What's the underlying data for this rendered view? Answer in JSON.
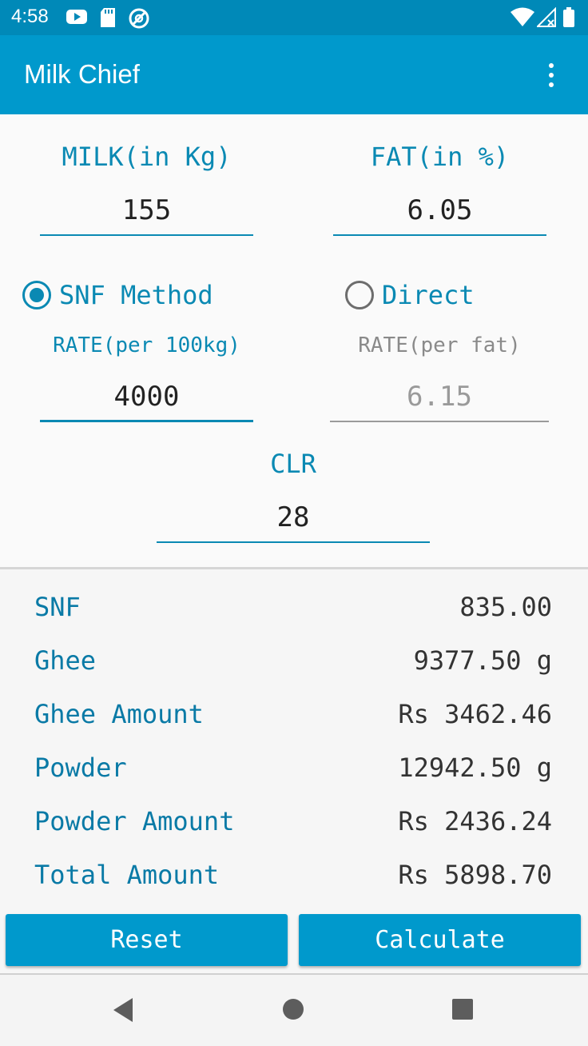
{
  "status_bar": {
    "time": "4:58",
    "left_icons": [
      "youtube-icon",
      "sd-card-icon",
      "vpn-icon"
    ],
    "right_icons": [
      "wifi-icon",
      "cell-signal-icon",
      "battery-icon"
    ]
  },
  "app_bar": {
    "title": "Milk Chief",
    "menu_icon": "overflow-menu-icon"
  },
  "inputs": {
    "milk_label": "MILK(in Kg)",
    "milk_value": "155",
    "fat_label": "FAT(in %)",
    "fat_value": "6.05",
    "method_options": [
      {
        "label": "SNF Method",
        "selected": true
      },
      {
        "label": "Direct",
        "selected": false
      }
    ],
    "rate_snf_label": "RATE(per 100kg)",
    "rate_snf_value": "4000",
    "rate_direct_label": "RATE(per fat)",
    "rate_direct_placeholder": "6.15",
    "clr_label": "CLR",
    "clr_value": "28"
  },
  "results": [
    {
      "label": "SNF",
      "value": "835.00"
    },
    {
      "label": "Ghee",
      "value": "9377.50 g"
    },
    {
      "label": "Ghee Amount",
      "value": "Rs 3462.46"
    },
    {
      "label": "Powder",
      "value": "12942.50 g"
    },
    {
      "label": "Powder Amount",
      "value": "Rs 2436.24"
    },
    {
      "label": "Total Amount",
      "value": "Rs 5898.70"
    }
  ],
  "buttons": {
    "reset": "Reset",
    "calculate": "Calculate"
  },
  "nav_bar": {
    "icons": [
      "back-icon",
      "home-icon",
      "recents-icon"
    ]
  },
  "colors": {
    "primary": "#0099cc",
    "primary_dark": "#0089b8",
    "accent_text": "#0a89b3",
    "background": "#fafafa"
  }
}
